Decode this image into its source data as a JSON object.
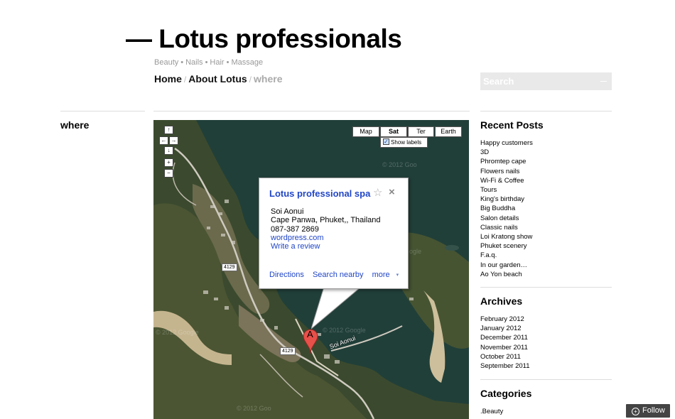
{
  "site": {
    "dash": "—",
    "title": "Lotus professionals",
    "tagline": [
      "Beauty",
      "Nails",
      "Hair",
      "Massage"
    ],
    "tagline_sep": "•"
  },
  "nav": {
    "home": "Home",
    "about": "About Lotus",
    "current": "where",
    "sep": "/"
  },
  "search": {
    "placeholder": "Search",
    "button_glyph": "—"
  },
  "page": {
    "title": "where"
  },
  "map": {
    "types": [
      "Map",
      "Sat",
      "Ter",
      "Earth"
    ],
    "active_type": "Sat",
    "show_labels": "Show labels",
    "pan_up": "↑",
    "pan_left": "←",
    "pan_right": "→",
    "pan_down": "↓",
    "pan_center": "",
    "zoom_in": "+",
    "zoom_out": "−",
    "watermarks": [
      "© 2012 Goo",
      "© 2012 Google",
      "© 2012 Google",
      "© 2012 Goo",
      "ogle"
    ],
    "road_badges": [
      "4129",
      "4129"
    ],
    "street": "Soi Aonui",
    "marker": "A",
    "infowindow": {
      "title": "Lotus professional spa",
      "star": "☆",
      "close": "×",
      "address1": "Soi Aonui",
      "address2": "Cape Panwa, Phuket,, Thailand",
      "phone": "087-387 2869",
      "website": "wordpress.com",
      "review": "Write a review",
      "directions": "Directions",
      "search_nearby": "Search nearby",
      "more": "more",
      "more_caret": "▾"
    }
  },
  "sidebar": {
    "recent_title": "Recent Posts",
    "recent": [
      "Happy customers",
      "3D",
      "Phromtep cape",
      "Flowers nails",
      "Wi-Fi & Coffee",
      "Tours",
      "King's birthday",
      "Big Buddha",
      "Salon details",
      "Classic nails",
      "Loi Kratong show",
      "Phuket scenery",
      "F.a.q.",
      "In our garden…",
      "Ao Yon beach"
    ],
    "archives_title": "Archives",
    "archives": [
      "February 2012",
      "January 2012",
      "December 2011",
      "November 2011",
      "October 2011",
      "September 2011"
    ],
    "categories_title": "Categories",
    "categories": [
      ".Beauty"
    ]
  },
  "follow": {
    "icon": "+",
    "label": "Follow"
  }
}
